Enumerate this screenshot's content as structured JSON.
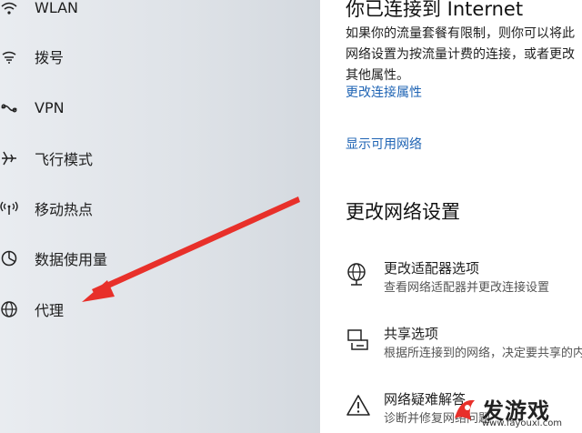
{
  "sidebar": {
    "items": [
      {
        "label": "WLAN",
        "icon": "wifi-icon"
      },
      {
        "label": "拨号",
        "icon": "dialup-icon"
      },
      {
        "label": "VPN",
        "icon": "vpn-icon"
      },
      {
        "label": "飞行模式",
        "icon": "airplane-icon"
      },
      {
        "label": "移动热点",
        "icon": "hotspot-icon"
      },
      {
        "label": "数据使用量",
        "icon": "data-usage-icon"
      },
      {
        "label": "代理",
        "icon": "globe-icon"
      }
    ]
  },
  "annotation": {
    "color": "#e8302a"
  },
  "main": {
    "status_title": "你已连接到 Internet",
    "status_desc": "如果你的流量套餐有限制，则你可以将此网络设置为按流量计费的连接，或者更改其他属性。",
    "link_change_props": "更改连接属性",
    "link_show_networks": "显示可用网络",
    "section_title": "更改网络设置",
    "options": [
      {
        "title": "更改适配器选项",
        "subtitle": "查看网络适配器并更改连接设置",
        "icon": "adapter-icon"
      },
      {
        "title": "共享选项",
        "subtitle": "根据所连接到的网络，决定要共享的内容",
        "icon": "sharing-icon"
      },
      {
        "title": "网络疑难解答",
        "subtitle": "诊断并修复网络问题",
        "icon": "warning-icon"
      }
    ]
  },
  "watermark": {
    "text": "发游戏",
    "url": "www.fayouxi.com"
  },
  "colors": {
    "link": "#1f64b4",
    "arrow": "#e8302a",
    "watermark_accent": "#e8302a"
  }
}
